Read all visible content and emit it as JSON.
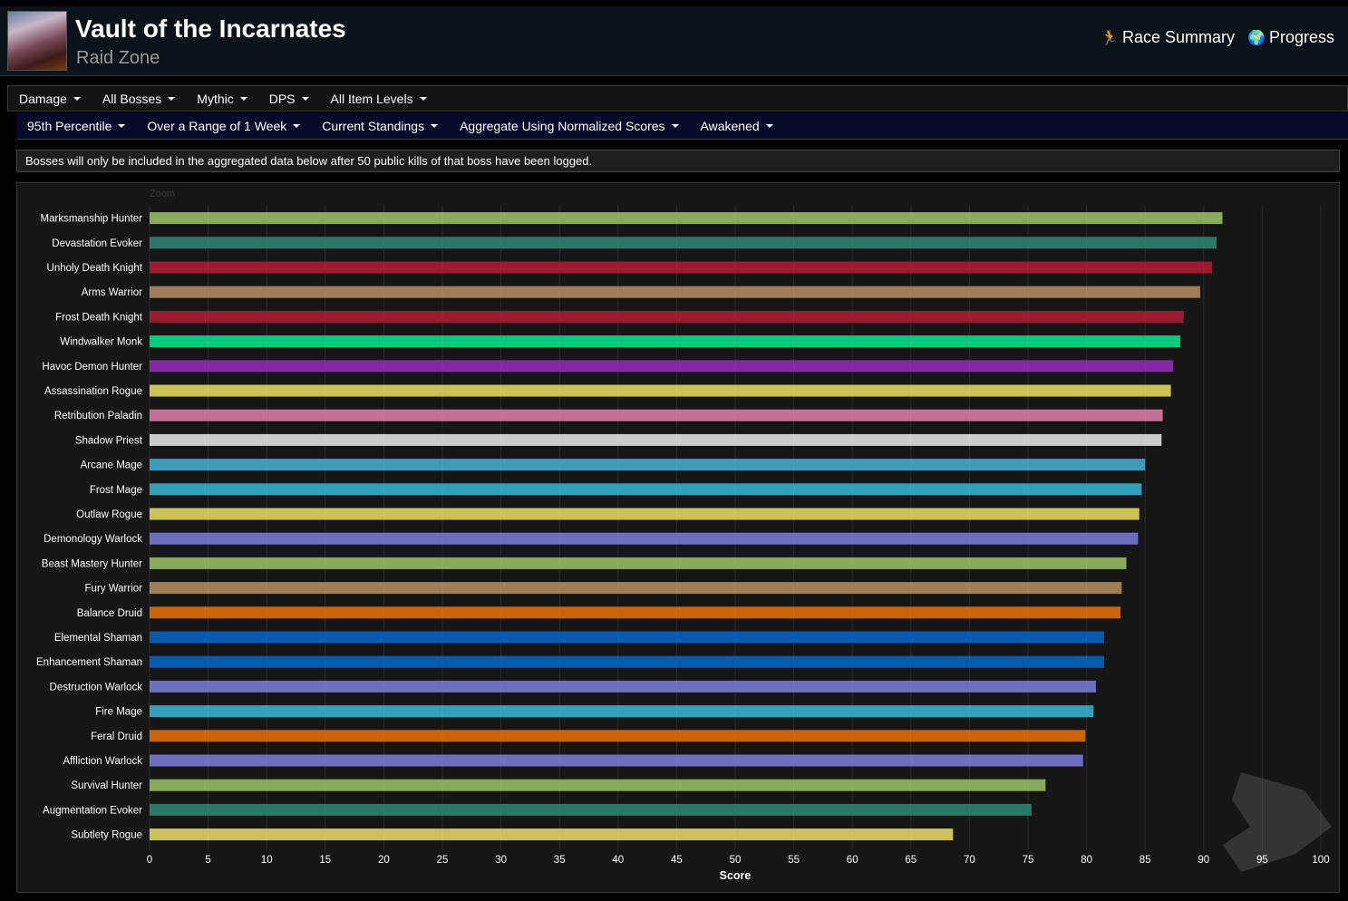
{
  "header": {
    "title": "Vault of the Incarnates",
    "subtitle": "Raid Zone",
    "links": [
      {
        "label": "Race Summary",
        "icon": "runner-icon"
      },
      {
        "label": "Progress",
        "icon": "globe-icon"
      }
    ]
  },
  "filters_primary": [
    "Damage",
    "All Bosses",
    "Mythic",
    "DPS",
    "All Item Levels"
  ],
  "filters_secondary": [
    "95th Percentile",
    "Over a Range of 1 Week",
    "Current Standings",
    "Aggregate Using Normalized Scores",
    "Awakened"
  ],
  "notice": "Bosses will only be included in the aggregated data below after 50 public kills of that boss have been logged.",
  "chart": {
    "zoom_label": "Zoom"
  },
  "chart_data": {
    "type": "bar",
    "orientation": "horizontal",
    "xlabel": "Score",
    "xlim": [
      0,
      100
    ],
    "xticks": [
      0,
      5,
      10,
      15,
      20,
      25,
      30,
      35,
      40,
      45,
      50,
      55,
      60,
      65,
      70,
      75,
      80,
      85,
      90,
      95,
      100
    ],
    "grid": true,
    "categories": [
      "Marksmanship Hunter",
      "Devastation Evoker",
      "Unholy Death Knight",
      "Arms Warrior",
      "Frost Death Knight",
      "Windwalker Monk",
      "Havoc Demon Hunter",
      "Assassination Rogue",
      "Retribution Paladin",
      "Shadow Priest",
      "Arcane Mage",
      "Frost Mage",
      "Outlaw Rogue",
      "Demonology Warlock",
      "Beast Mastery Hunter",
      "Fury Warrior",
      "Balance Druid",
      "Elemental Shaman",
      "Enhancement Shaman",
      "Destruction Warlock",
      "Fire Mage",
      "Feral Druid",
      "Affliction Warlock",
      "Survival Hunter",
      "Augmentation Evoker",
      "Subtlety Rogue"
    ],
    "values": [
      91.6,
      91.1,
      90.7,
      89.7,
      88.3,
      88.0,
      87.4,
      87.2,
      86.5,
      86.4,
      85.0,
      84.7,
      84.5,
      84.4,
      83.4,
      83.0,
      82.9,
      81.5,
      81.5,
      80.8,
      80.6,
      79.9,
      79.7,
      76.5,
      75.3,
      68.6
    ],
    "colors": [
      "#aad372",
      "#33937f",
      "#c41e3a",
      "#c69b6d",
      "#c41e3a",
      "#00ff98",
      "#a330c9",
      "#fff468",
      "#f48cba",
      "#ffffff",
      "#3fc7eb",
      "#3fc7eb",
      "#fff468",
      "#8788ee",
      "#aad372",
      "#c69b6d",
      "#ff7c0a",
      "#0070dd",
      "#0070dd",
      "#8788ee",
      "#3fc7eb",
      "#ff7c0a",
      "#8788ee",
      "#aad372",
      "#33937f",
      "#fff468"
    ]
  }
}
